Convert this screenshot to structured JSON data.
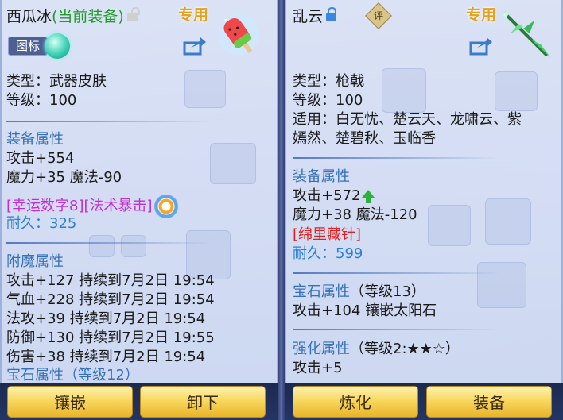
{
  "left": {
    "name": "西瓜冰",
    "status": "(当前装备)",
    "exclusive_label": "专用",
    "tag_button": "图标",
    "type_line": "类型：武器皮肤",
    "level_line": "等级：100",
    "equip_section": "装备属性",
    "equip_attrs": [
      "攻击+554",
      "魔力+35 魔法-90"
    ],
    "special_line": "[幸运数字8][法术暴击]",
    "durability_label": "耐久：",
    "durability_value": "325",
    "enchant_section": "附魔属性",
    "enchant_attrs": [
      "攻击+127 持续到7月2日 19:54",
      "气血+228 持续到7月2日 19:54",
      "法攻+39 持续到7月2日 19:54",
      "防御+130 持续到7月2日 19:55",
      "伤害+38 持续到7月2日 19:54"
    ],
    "gem_section_partial": "宝石属性（等级12）",
    "buttons": {
      "inlay": "镶嵌",
      "unequip": "卸下"
    }
  },
  "right": {
    "name": "乱云",
    "appraise_label": "评",
    "exclusive_label": "专用",
    "type_line": "类型：枪戟",
    "level_line": "等级：100",
    "suitable_line1": "适用：白无忧、楚云天、龙啸云、紫",
    "suitable_line2": "嫣然、楚碧秋、玉临香",
    "equip_section": "装备属性",
    "equip_attrs": [
      "攻击+572",
      "魔力+38 魔法-120"
    ],
    "special_line": "[绵里藏针]",
    "durability_label": "耐久：",
    "durability_value": "599",
    "gem_section": "宝石属性",
    "gem_level": "（等级13）",
    "gem_attr": "攻击+104 镶嵌太阳石",
    "enhance_section": "强化属性",
    "enhance_level": "（等级2:★★☆）",
    "enhance_attr": "攻击+5",
    "buttons": {
      "refine": "炼化",
      "equip": "装备"
    }
  },
  "icons": {
    "left_lock": "unlocked-lock-icon",
    "right_lock": "locked-lock-icon",
    "share": "share-icon",
    "orb": "jade-orb-icon",
    "refresh": "refresh-icon",
    "upgrade": "green-up-arrow-icon",
    "left_item": "watermelon-popsicle-weapon-icon",
    "right_item": "green-spear-weapon-icon"
  },
  "colors": {
    "section": "#3470b8",
    "durability": "#2a7fd8",
    "special_right": "#e02020",
    "special_left": "#c030d0",
    "exclusive": "#e8a01a",
    "current_equip": "#1f9a2a",
    "button_gold": "#f8d860"
  }
}
